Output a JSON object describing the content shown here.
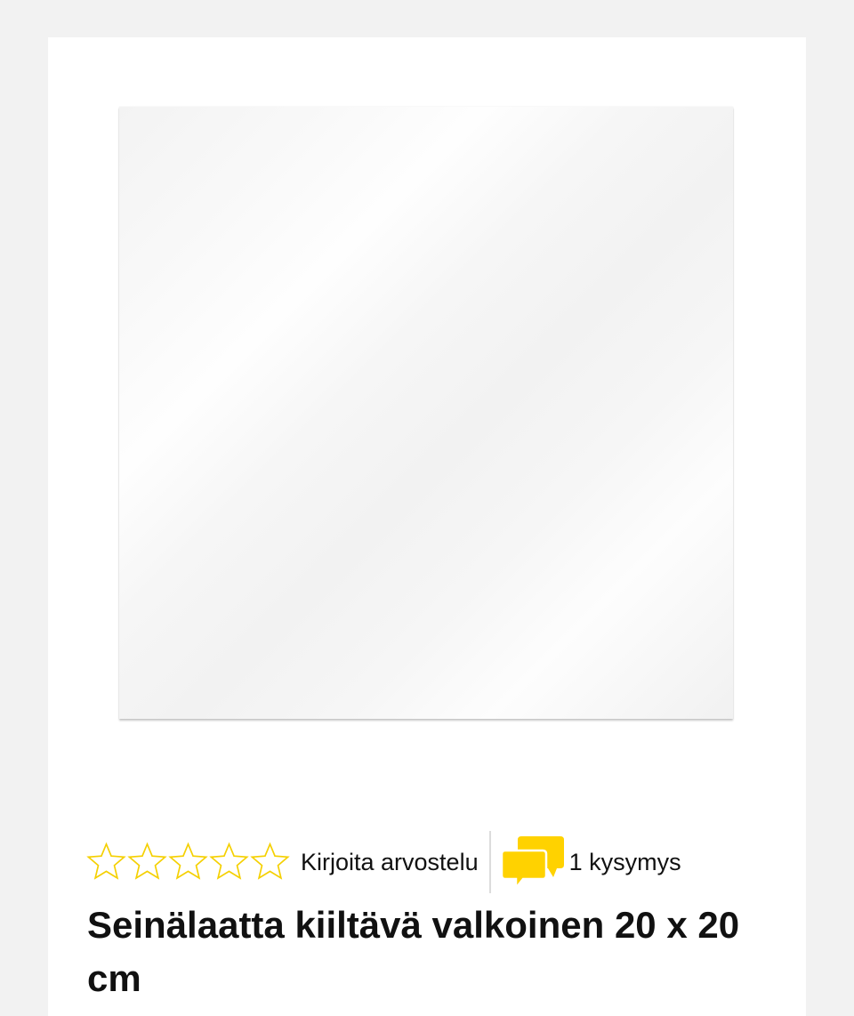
{
  "product": {
    "image_alt": "Seinälaatta kiiltävä valkoinen 20 x 20 cm",
    "title": "Seinälaatta kiiltävä valkoinen 20 x 20 cm"
  },
  "rating": {
    "stars_total": 5,
    "stars_filled": 0,
    "star_color": "#f5d000",
    "write_review_label": "Kirjoita arvostelu"
  },
  "questions": {
    "label": "1 kysymys",
    "icon": "chat-bubbles-icon",
    "icon_color": "#ffd200"
  }
}
